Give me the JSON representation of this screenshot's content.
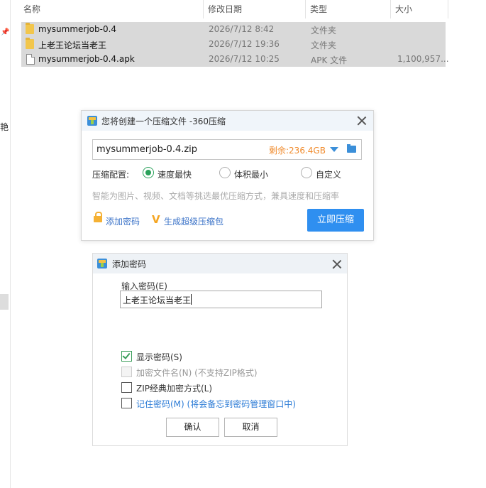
{
  "explorer": {
    "left_glyph": "艳",
    "columns": [
      "名称",
      "修改日期",
      "类型",
      "大小"
    ],
    "files": [
      {
        "name": "mysummerjob-0.4",
        "date": "2026/7/12 8:42",
        "type": "文件夹",
        "size": "",
        "icon": "folder-icon"
      },
      {
        "name": "上老王论坛当老王",
        "date": "2026/7/12 19:36",
        "type": "文件夹",
        "size": "",
        "icon": "folder-icon"
      },
      {
        "name": "mysummerjob-0.4.apk",
        "date": "2026/7/12 10:25",
        "type": "APK 文件",
        "size": "1,100,957...",
        "icon": "file-icon"
      }
    ]
  },
  "compress_dialog": {
    "title": "您将创建一个压缩文件 -360压缩",
    "filename": "mysummerjob-0.4.zip",
    "free_space": "剩余:236.4GB",
    "config_label": "压缩配置:",
    "options": [
      {
        "label": "速度最快",
        "selected": true
      },
      {
        "label": "体积最小",
        "selected": false
      },
      {
        "label": "自定义",
        "selected": false
      }
    ],
    "hint": "智能为图片、视频、文档等挑选最优压缩方式，兼具速度和压缩率",
    "add_password": "添加密码",
    "super_pack": "生成超级压缩包",
    "compress_now": "立即压缩",
    "accent_color": "#2f8ff0"
  },
  "password_dialog": {
    "title": "添加密码",
    "input_label": "输入密码(E)",
    "password_value": "上老王论坛当老王",
    "checkboxes": [
      {
        "label": "显示密码(S)",
        "checked": true,
        "disabled": false
      },
      {
        "label": "加密文件名(N) (不支持ZIP格式)",
        "checked": false,
        "disabled": true
      },
      {
        "label": "ZIP经典加密方式(L)",
        "checked": false,
        "disabled": false
      },
      {
        "label": "记住密码(M) (将会备忘到密码管理窗口中)",
        "checked": false,
        "disabled": false
      }
    ],
    "ok": "确认",
    "cancel": "取消"
  }
}
